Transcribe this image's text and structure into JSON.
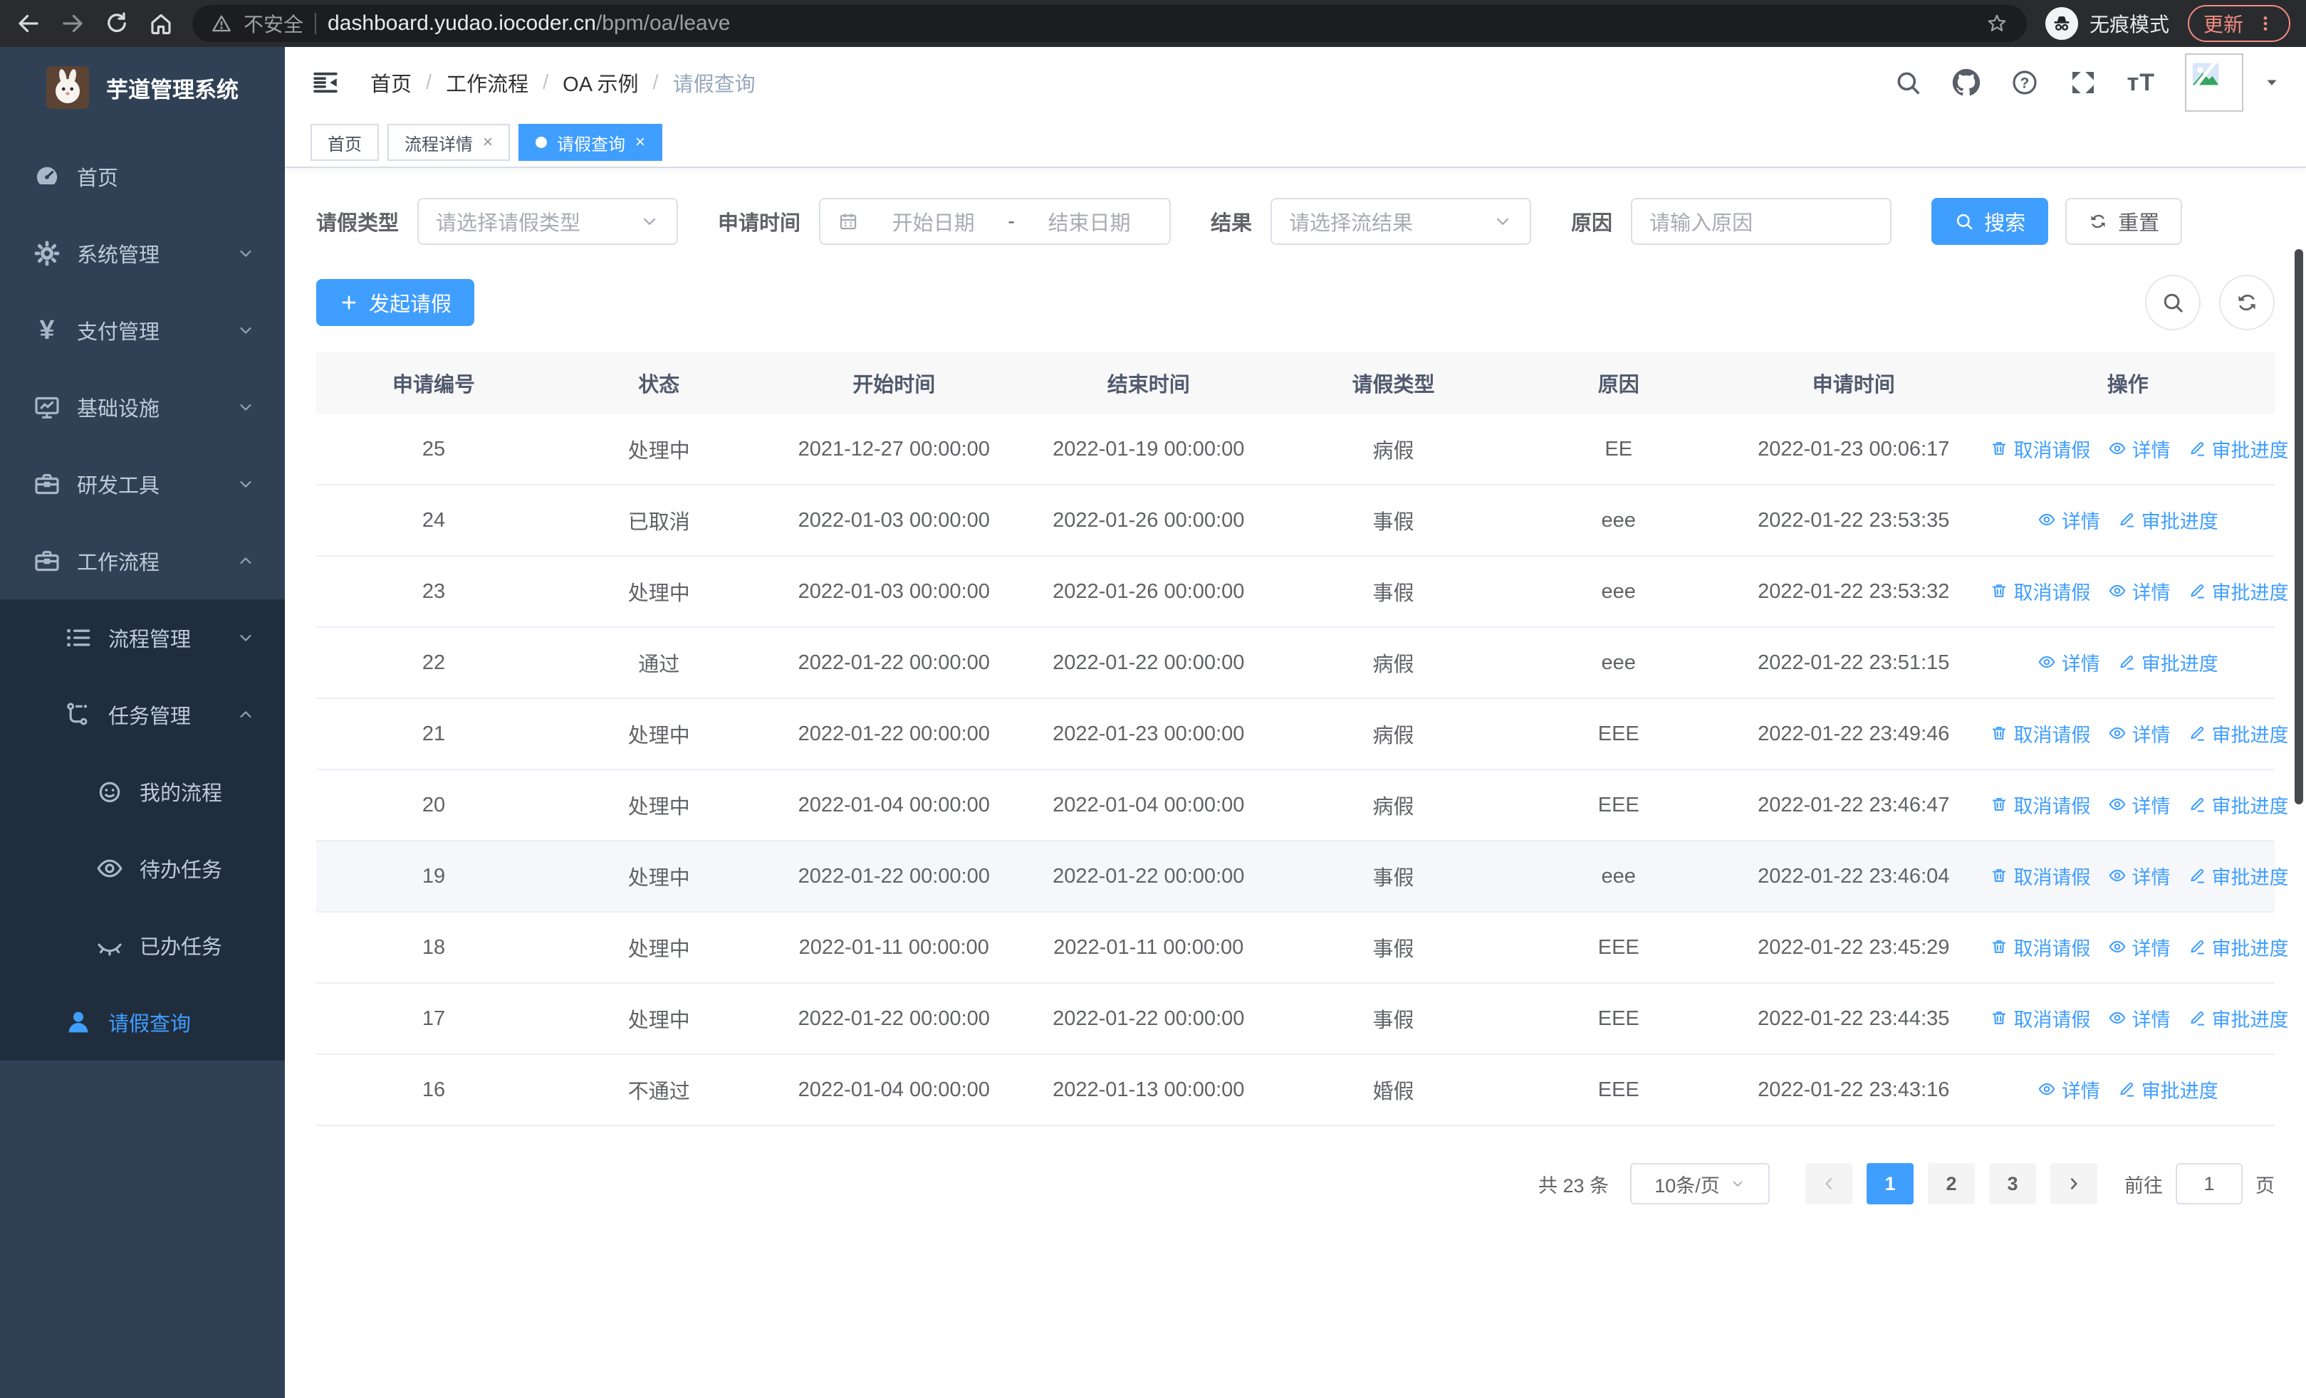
{
  "browser": {
    "security_label": "不安全",
    "url_host": "dashboard.yudao.iocoder.cn",
    "url_path": "/bpm/oa/leave",
    "incognito_label": "无痕模式",
    "update_label": "更新"
  },
  "sidebar": {
    "app_title": "芋道管理系统",
    "items": [
      {
        "label": "首页",
        "icon": "dashboard-icon",
        "level": 0,
        "arrow": null,
        "submenu": false,
        "active": false
      },
      {
        "label": "系统管理",
        "icon": "gear-icon",
        "level": 0,
        "arrow": "down",
        "submenu": false,
        "active": false
      },
      {
        "label": "支付管理",
        "icon": "yen-icon",
        "level": 0,
        "arrow": "down",
        "submenu": false,
        "active": false
      },
      {
        "label": "基础设施",
        "icon": "monitor-icon",
        "level": 0,
        "arrow": "down",
        "submenu": false,
        "active": false
      },
      {
        "label": "研发工具",
        "icon": "toolbox-icon",
        "level": 0,
        "arrow": "down",
        "submenu": false,
        "active": false
      },
      {
        "label": "工作流程",
        "icon": "briefcase-icon",
        "level": 0,
        "arrow": "up",
        "submenu": false,
        "active": false
      },
      {
        "label": "流程管理",
        "icon": "list-icon",
        "level": 1,
        "arrow": "down",
        "submenu": true,
        "active": false
      },
      {
        "label": "任务管理",
        "icon": "flow-icon",
        "level": 1,
        "arrow": "up",
        "submenu": true,
        "active": false
      },
      {
        "label": "我的流程",
        "icon": "robot-icon",
        "level": 2,
        "arrow": null,
        "submenu": true,
        "active": false
      },
      {
        "label": "待办任务",
        "icon": "eye-icon",
        "level": 2,
        "arrow": null,
        "submenu": true,
        "active": false
      },
      {
        "label": "已办任务",
        "icon": "eye-closed-icon",
        "level": 2,
        "arrow": null,
        "submenu": true,
        "active": false
      },
      {
        "label": "请假查询",
        "icon": "user-icon",
        "level": 1,
        "arrow": null,
        "submenu": true,
        "active": true
      }
    ]
  },
  "breadcrumb": {
    "separator": "/",
    "items": [
      "首页",
      "工作流程",
      "OA 示例",
      "请假查询"
    ]
  },
  "tabs": [
    {
      "label": "首页",
      "closable": false,
      "active": false
    },
    {
      "label": "流程详情",
      "closable": true,
      "active": false
    },
    {
      "label": "请假查询",
      "closable": true,
      "active": true
    }
  ],
  "filters": {
    "leave_type_label": "请假类型",
    "leave_type_placeholder": "请选择请假类型",
    "apply_time_label": "申请时间",
    "start_date_placeholder": "开始日期",
    "range_separator": "-",
    "end_date_placeholder": "结束日期",
    "result_label": "结果",
    "result_placeholder": "请选择流结果",
    "reason_label": "原因",
    "reason_placeholder": "请输入原因",
    "search_label": "搜索",
    "reset_label": "重置"
  },
  "toolbar": {
    "create_label": "发起请假"
  },
  "table": {
    "columns": [
      "申请编号",
      "状态",
      "开始时间",
      "结束时间",
      "请假类型",
      "原因",
      "申请时间",
      "操作"
    ],
    "actions": {
      "cancel": "取消请假",
      "detail": "详情",
      "progress": "审批进度"
    },
    "rows": [
      {
        "id": "25",
        "status": "处理中",
        "start": "2021-12-27 00:00:00",
        "end": "2022-01-19 00:00:00",
        "type": "病假",
        "reason": "EE",
        "apply_time": "2022-01-23 00:06:17",
        "cancellable": true,
        "highlight": false
      },
      {
        "id": "24",
        "status": "已取消",
        "start": "2022-01-03 00:00:00",
        "end": "2022-01-26 00:00:00",
        "type": "事假",
        "reason": "eee",
        "apply_time": "2022-01-22 23:53:35",
        "cancellable": false,
        "highlight": false
      },
      {
        "id": "23",
        "status": "处理中",
        "start": "2022-01-03 00:00:00",
        "end": "2022-01-26 00:00:00",
        "type": "事假",
        "reason": "eee",
        "apply_time": "2022-01-22 23:53:32",
        "cancellable": true,
        "highlight": false
      },
      {
        "id": "22",
        "status": "通过",
        "start": "2022-01-22 00:00:00",
        "end": "2022-01-22 00:00:00",
        "type": "病假",
        "reason": "eee",
        "apply_time": "2022-01-22 23:51:15",
        "cancellable": false,
        "highlight": false
      },
      {
        "id": "21",
        "status": "处理中",
        "start": "2022-01-22 00:00:00",
        "end": "2022-01-23 00:00:00",
        "type": "病假",
        "reason": "EEE",
        "apply_time": "2022-01-22 23:49:46",
        "cancellable": true,
        "highlight": false
      },
      {
        "id": "20",
        "status": "处理中",
        "start": "2022-01-04 00:00:00",
        "end": "2022-01-04 00:00:00",
        "type": "病假",
        "reason": "EEE",
        "apply_time": "2022-01-22 23:46:47",
        "cancellable": true,
        "highlight": false
      },
      {
        "id": "19",
        "status": "处理中",
        "start": "2022-01-22 00:00:00",
        "end": "2022-01-22 00:00:00",
        "type": "事假",
        "reason": "eee",
        "apply_time": "2022-01-22 23:46:04",
        "cancellable": true,
        "highlight": true
      },
      {
        "id": "18",
        "status": "处理中",
        "start": "2022-01-11 00:00:00",
        "end": "2022-01-11 00:00:00",
        "type": "事假",
        "reason": "EEE",
        "apply_time": "2022-01-22 23:45:29",
        "cancellable": true,
        "highlight": false
      },
      {
        "id": "17",
        "status": "处理中",
        "start": "2022-01-22 00:00:00",
        "end": "2022-01-22 00:00:00",
        "type": "事假",
        "reason": "EEE",
        "apply_time": "2022-01-22 23:44:35",
        "cancellable": true,
        "highlight": false
      },
      {
        "id": "16",
        "status": "不通过",
        "start": "2022-01-04 00:00:00",
        "end": "2022-01-13 00:00:00",
        "type": "婚假",
        "reason": "EEE",
        "apply_time": "2022-01-22 23:43:16",
        "cancellable": false,
        "highlight": false
      }
    ]
  },
  "pagination": {
    "total_label": "共 23 条",
    "page_size_label": "10条/页",
    "pages": [
      "1",
      "2",
      "3"
    ],
    "active_page": "1",
    "goto_label": "前往",
    "goto_value": "1",
    "goto_suffix": "页"
  },
  "colors": {
    "accent": "#409eff",
    "sidebar_bg": "#304156",
    "submenu_bg": "#1f2d3d",
    "table_header_bg": "#f8f8f9",
    "update_accent": "#f28b82"
  },
  "icons": {
    "back-icon": "left arrow",
    "forward-icon": "right arrow",
    "reload-icon": "circular arrow",
    "home-icon": "house",
    "warning-icon": "alert triangle",
    "star-icon": "bookmark star",
    "incognito-icon": "hat and glasses",
    "kebab-icon": "vertical dots",
    "dashboard-icon": "speedometer",
    "gear-icon": "cog",
    "yen-icon": "yen sign",
    "monitor-icon": "screen with chart",
    "toolbox-icon": "toolbox",
    "briefcase-icon": "briefcase",
    "list-icon": "indented list",
    "flow-icon": "branch flow",
    "robot-icon": "smiley face",
    "eye-icon": "open eye",
    "eye-closed-icon": "closed eye",
    "user-icon": "person",
    "hamburger-icon": "collapse menu",
    "search-icon": "magnifier",
    "github-icon": "github cat",
    "question-icon": "question circle",
    "fullscreen-icon": "expand arrows",
    "fontsize-icon": "tT",
    "broken-image-icon": "landscape placeholder",
    "caret-down-icon": "small triangle",
    "chevron-down-icon": "chevron down",
    "chevron-up-icon": "chevron up",
    "chevron-left-icon": "chevron left",
    "chevron-right-icon": "chevron right",
    "calendar-icon": "calendar",
    "plus-icon": "plus",
    "refresh-icon": "refresh arrows",
    "trash-icon": "trash can",
    "edit-icon": "pen"
  }
}
